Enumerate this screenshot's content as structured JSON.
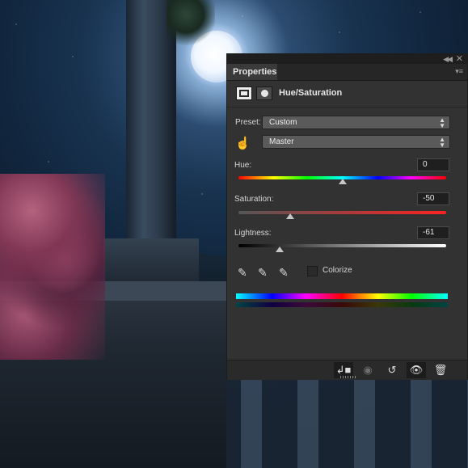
{
  "panel": {
    "tab_label": "Properties",
    "adjustment_title": "Hue/Saturation",
    "preset": {
      "label": "Preset:",
      "value": "Custom"
    },
    "channel": {
      "value": "Master"
    },
    "hue": {
      "label": "Hue:",
      "value": "0",
      "slider_fraction": 0.5
    },
    "saturation": {
      "label": "Saturation:",
      "value": "-50",
      "slider_fraction": 0.25
    },
    "lightness": {
      "label": "Lightness:",
      "value": "-61",
      "slider_fraction": 0.2
    },
    "colorize": {
      "label": "Colorize",
      "checked": false
    }
  },
  "icons": {
    "window_collapse": "double-chevron-left-icon",
    "window_close": "close-icon",
    "panel_menu": "panel-menu-icon",
    "adjustment": "hue-saturation-adjustment-icon",
    "mask": "layer-mask-icon",
    "targeted_adjust": "hand-targeted-adjust-icon",
    "eyedroppers": [
      "eyedropper-icon",
      "eyedropper-plus-icon",
      "eyedropper-minus-icon"
    ],
    "bottom_bar": [
      "clip-to-layer-icon",
      "view-previous-state-icon",
      "reset-icon",
      "visibility-eye-icon",
      "trash-icon"
    ]
  },
  "colors": {
    "panel_bg": "#323232",
    "sky_dark": "#0f2238",
    "moon": "#f1f7ff"
  }
}
